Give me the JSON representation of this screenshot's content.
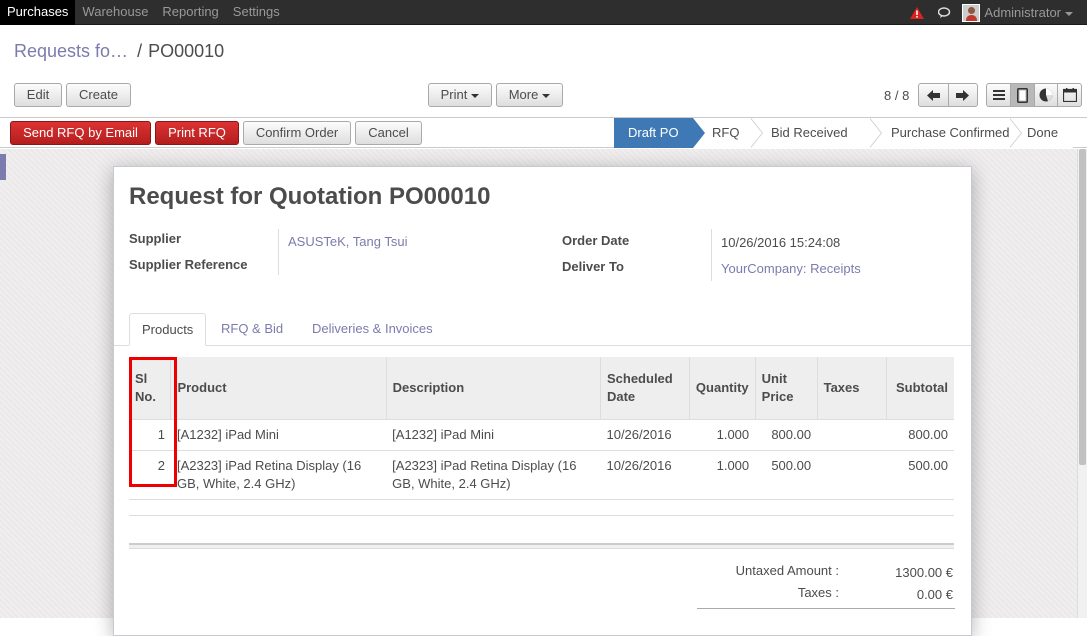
{
  "topbar": {
    "menu": [
      "Purchases",
      "Warehouse",
      "Reporting",
      "Settings"
    ],
    "user": "Administrator"
  },
  "breadcrumb": {
    "parent": "Requests fo…",
    "current": "PO00010"
  },
  "toolbar": {
    "edit": "Edit",
    "create": "Create",
    "print": "Print",
    "more": "More",
    "pager": "8 / 8"
  },
  "actions": {
    "send_rfq": "Send RFQ by Email",
    "print_rfq": "Print RFQ",
    "confirm": "Confirm Order",
    "cancel": "Cancel"
  },
  "stages": [
    "Draft PO",
    "RFQ",
    "Bid Received",
    "Purchase Confirmed",
    "Done"
  ],
  "form": {
    "title_prefix": "Request for Quotation",
    "title_number": "PO00010",
    "supplier_label": "Supplier",
    "supplier_value": "ASUSTeK, Tang Tsui",
    "supplier_ref_label": "Supplier Reference",
    "order_date_label": "Order Date",
    "order_date_value": "10/26/2016 15:24:08",
    "deliver_to_label": "Deliver To",
    "deliver_to_value": "YourCompany: Receipts"
  },
  "tabs": [
    "Products",
    "RFQ & Bid",
    "Deliveries & Invoices"
  ],
  "table": {
    "headers": {
      "sl_line1": "Sl",
      "sl_line2": "No.",
      "product": "Product",
      "description": "Description",
      "sched_line1": "Scheduled",
      "sched_line2": "Date",
      "quantity": "Quantity",
      "price_line1": "Unit",
      "price_line2": "Price",
      "taxes": "Taxes",
      "subtotal": "Subtotal"
    },
    "rows": [
      {
        "sl": "1",
        "product": "[A1232] iPad Mini",
        "description": "[A1232] iPad Mini",
        "date": "10/26/2016",
        "qty": "1.000",
        "price": "800.00",
        "taxes": "",
        "subtotal": "800.00"
      },
      {
        "sl": "2",
        "product": "[A2323] iPad Retina Display (16 GB, White, 2.4 GHz)",
        "description": "[A2323] iPad Retina Display (16 GB, White, 2.4 GHz)",
        "date": "10/26/2016",
        "qty": "1.000",
        "price": "500.00",
        "taxes": "",
        "subtotal": "500.00"
      }
    ]
  },
  "totals": {
    "untaxed_label": "Untaxed Amount :",
    "untaxed_value": "1300.00 €",
    "taxes_label": "Taxes :",
    "taxes_value": "0.00 €"
  },
  "colors": {
    "accent": "#7c7bad",
    "primary_button": "#c62828",
    "active_stage": "#3f79b5",
    "highlight_box": "#e00000"
  },
  "icons": [
    "warning-icon",
    "chat-icon",
    "avatar",
    "prev-icon",
    "next-icon",
    "list-view-icon",
    "form-view-icon",
    "graph-view-icon",
    "calendar-view-icon"
  ]
}
